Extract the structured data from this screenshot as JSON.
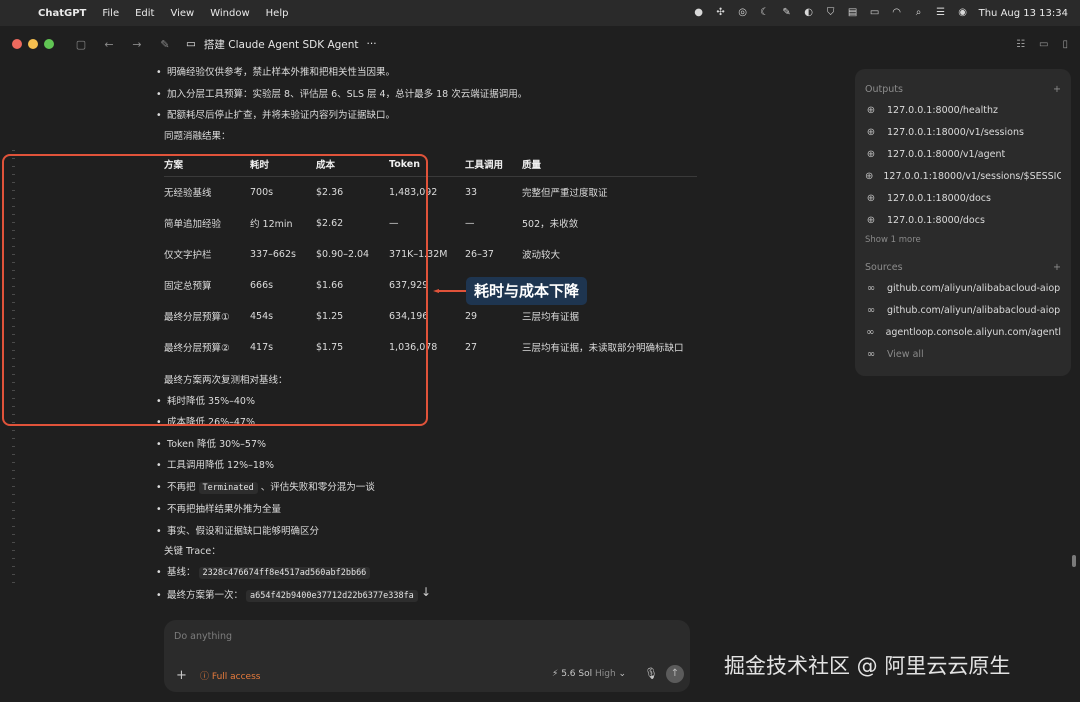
{
  "menubar": {
    "app": "ChatGPT",
    "items": [
      "File",
      "Edit",
      "View",
      "Window",
      "Help"
    ],
    "clock": "Thu Aug 13  13:34"
  },
  "window": {
    "title": "搭建 Claude Agent SDK Agent",
    "more": "···"
  },
  "conversation": {
    "bullets_top": [
      "明确经验仅供参考，禁止样本外推和把相关性当因果。",
      "加入分层工具预算：实验层 8、评估层 6、SLS 层 4，总计最多 18 次云端证据调用。",
      "配额耗尽后停止扩查，并将未验证内容列为证据缺口。"
    ],
    "ablation_heading": "同题消融结果：",
    "table": {
      "headers": [
        "方案",
        "耗时",
        "成本",
        "Token",
        "工具调用",
        "质量"
      ],
      "rows": [
        [
          "无经验基线",
          "700s",
          "$2.36",
          "1,483,092",
          "33",
          "完整但严重过度取证"
        ],
        [
          "简单追加经验",
          "约 12min",
          "$2.62",
          "—",
          "—",
          "502，未收敛"
        ],
        [
          "仅文字护栏",
          "337–662s",
          "$0.90–2.04",
          "371K–1.32M",
          "26–37",
          "波动较大"
        ],
        [
          "固定总预算",
          "666s",
          "$1.66",
          "637,929",
          "",
          ""
        ],
        [
          "最终分层预算①",
          "454s",
          "$1.25",
          "634,196",
          "29",
          "三层均有证据"
        ],
        [
          "最终分层预算②",
          "417s",
          "$1.75",
          "1,036,078",
          "27",
          "三层均有证据，未读取部分明确标缺口"
        ]
      ]
    },
    "summary_heading": "最终方案两次复测相对基线：",
    "summary_bullets": [
      "耗时降低 35%–40%",
      "成本降低 26%–47%",
      "Token 降低 30%–57%",
      "工具调用降低 12%–18%"
    ],
    "terminated_prefix": "不再把",
    "terminated_code": "Terminated",
    "terminated_suffix": "、评估失败和零分混为一谈",
    "extra_bullets": [
      "不再把抽样结果外推为全量",
      "事实、假设和证据缺口能够明确区分"
    ],
    "trace_heading": "关键 Trace：",
    "traces": [
      {
        "label": "基线：",
        "id": "2328c476674ff8e4517ad560abf2bb66"
      },
      {
        "label": "最终方案第一次：",
        "id": "a654f42b9400e37712d22b6377e338fa"
      }
    ]
  },
  "annotation": {
    "label": "耗时与成本下降",
    "color": "#e0533a"
  },
  "side_panel": {
    "outputs_title": "Outputs",
    "outputs": [
      "127.0.0.1:8000/healthz",
      "127.0.0.1:18000/v1/sessions",
      "127.0.0.1:8000/v1/agent",
      "127.0.0.1:18000/v1/sessions/$SESSIO",
      "127.0.0.1:18000/docs",
      "127.0.0.1:8000/docs"
    ],
    "show_more": "Show 1 more",
    "sources_title": "Sources",
    "sources": [
      "github.com/aliyun/alibabacloud-aiop",
      "github.com/aliyun/alibabacloud-aiop",
      "agentloop.console.aliyun.com/agentl"
    ],
    "view_all": "View all"
  },
  "composer": {
    "placeholder": "Do anything",
    "access": "Full access",
    "model": "5.6 Sol",
    "effort": "High"
  },
  "watermark": "掘金技术社区 @ 阿里云云原生",
  "icons": [
    "apple-icon",
    "globe-icon",
    "link-icon",
    "plus-icon",
    "mic-icon",
    "send-arrow-icon",
    "chevron-down-icon"
  ]
}
